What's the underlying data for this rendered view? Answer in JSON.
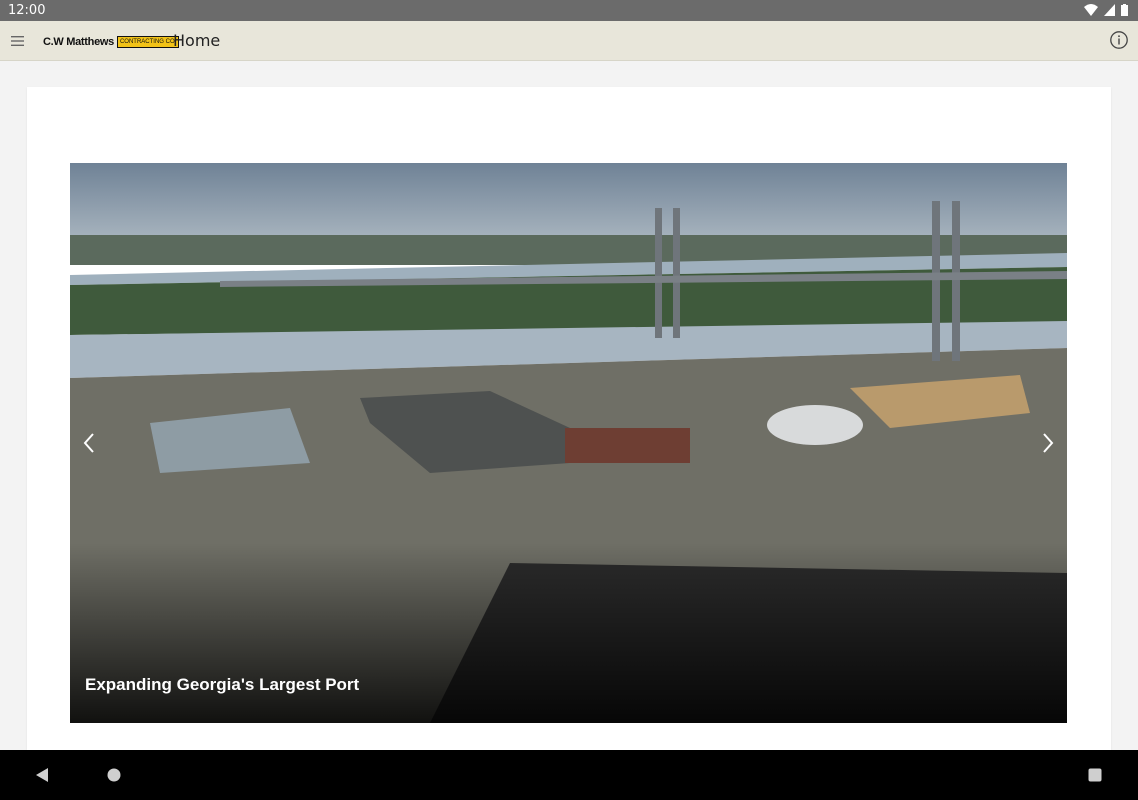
{
  "status_bar": {
    "time": "12:00"
  },
  "app_bar": {
    "logo_text": "C.W Matthews",
    "logo_badge": "Contracting Co.",
    "title": "Home"
  },
  "carousel": {
    "slide_caption": "Expanding Georgia's Largest Port"
  },
  "icons": {
    "menu": "hamburger-menu-icon",
    "info": "info-icon",
    "prev": "chevron-left-icon",
    "next": "chevron-right-icon"
  },
  "colors": {
    "status_bar": "#6b6b6b",
    "app_bar": "#e8e6da",
    "logo_badge": "#f2c318"
  }
}
